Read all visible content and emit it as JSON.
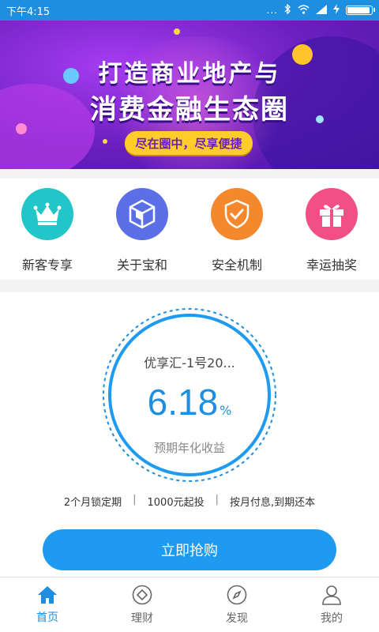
{
  "status_bar": {
    "time": "下午4:15",
    "dots": "...",
    "icons": [
      "bluetooth-icon",
      "wifi-icon",
      "signal-icon",
      "charging-icon",
      "battery-icon"
    ]
  },
  "banner": {
    "title_line1": "打造商业地产与",
    "title_line2": "消费金融生态圈",
    "slogan": "尽在圈中，尽享便捷",
    "page_count": 2,
    "active_page": 2
  },
  "quick_entries": [
    {
      "label": "新客专享",
      "icon": "crown-icon",
      "color": "#22c6c8"
    },
    {
      "label": "关于宝和",
      "icon": "cube-logo-icon",
      "color": "#5b6fe6"
    },
    {
      "label": "安全机制",
      "icon": "shield-check-icon",
      "color": "#f5872d"
    },
    {
      "label": "幸运抽奖",
      "icon": "gift-icon",
      "color": "#f24f86"
    }
  ],
  "product": {
    "name": "优享汇-1号20...",
    "rate": "6.18",
    "rate_unit": "%",
    "rate_label": "预期年化收益",
    "terms": [
      "2个月锁定期",
      "1000元起投",
      "按月付息,到期还本"
    ],
    "term_separator": "|",
    "buy_label": "立即抢购"
  },
  "tabbar": [
    {
      "label": "首页",
      "icon": "home-icon",
      "active": true
    },
    {
      "label": "理财",
      "icon": "finance-icon",
      "active": false
    },
    {
      "label": "发现",
      "icon": "compass-icon",
      "active": false
    },
    {
      "label": "我的",
      "icon": "user-icon",
      "active": false
    }
  ],
  "colors": {
    "primary": "#1e8fe0",
    "button": "#1e9af0",
    "banner_purple": "#6a1fbf",
    "banner_pill": "#ffcc2b"
  }
}
